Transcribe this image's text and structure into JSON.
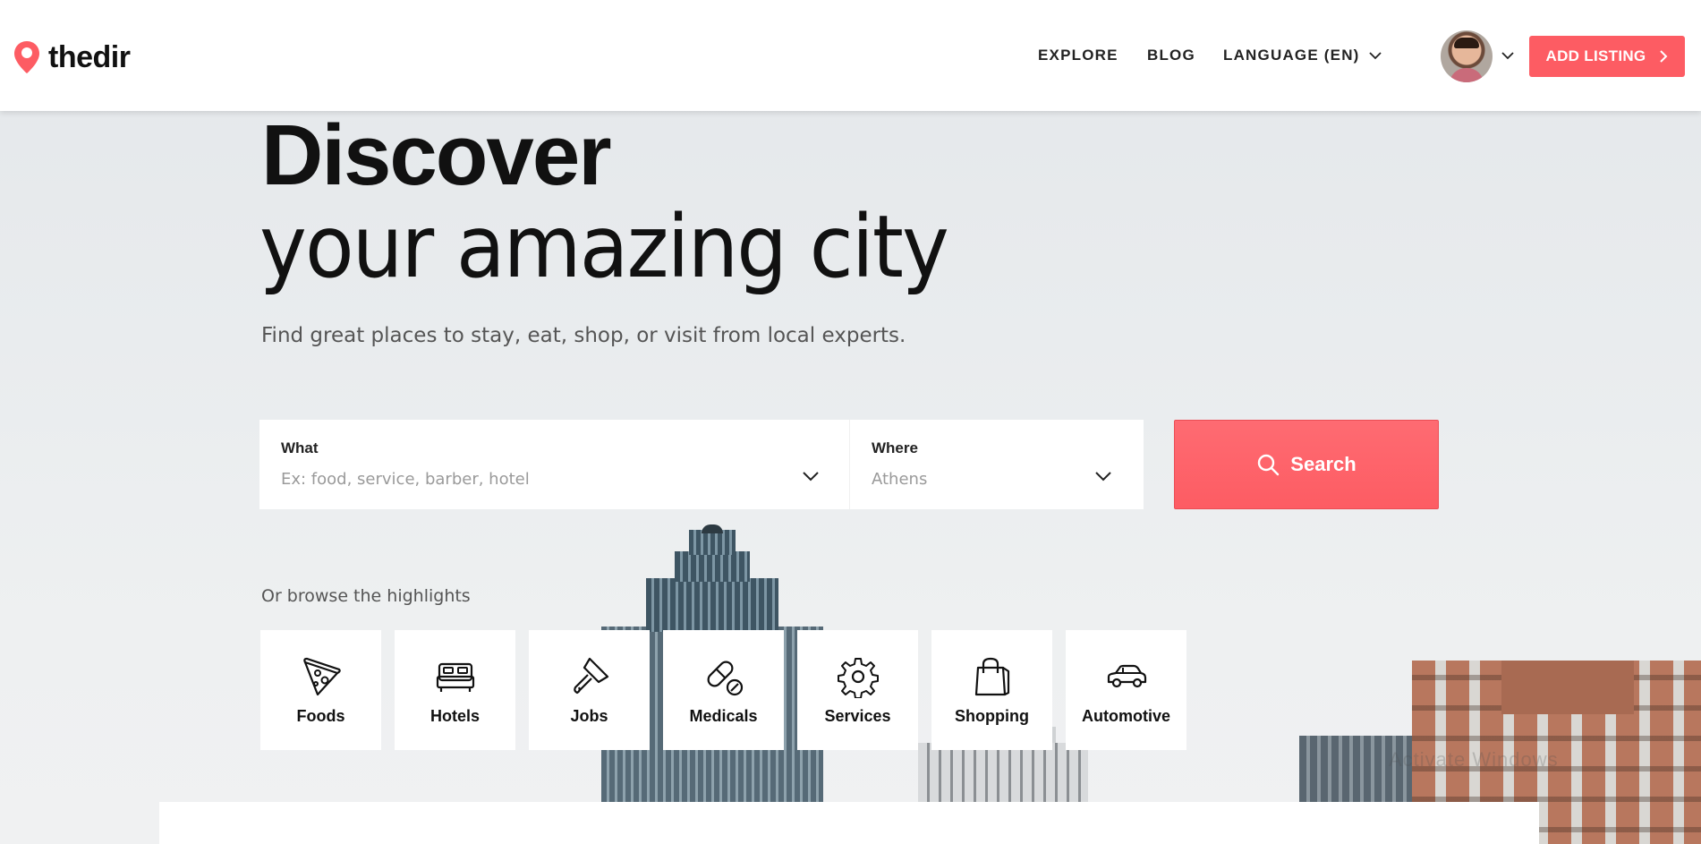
{
  "header": {
    "logo_text": "thedir",
    "nav": {
      "explore": "EXPLORE",
      "blog": "BLOG",
      "language": "LANGUAGE (EN)"
    },
    "add_listing": "ADD LISTING"
  },
  "hero": {
    "title_line1": "Discover",
    "title_line2": "your amazing city",
    "subtitle": "Find great places to stay, eat, shop, or visit from local experts."
  },
  "search": {
    "what_label": "What",
    "what_placeholder": "Ex: food, service, barber, hotel",
    "where_label": "Where",
    "where_placeholder": "Athens",
    "button_label": "Search"
  },
  "highlights": {
    "label": "Or browse the highlights",
    "categories": [
      {
        "label": "Foods",
        "icon": "pizza-icon"
      },
      {
        "label": "Hotels",
        "icon": "bed-icon"
      },
      {
        "label": "Jobs",
        "icon": "paint-brush-icon"
      },
      {
        "label": "Medicals",
        "icon": "pill-icon"
      },
      {
        "label": "Services",
        "icon": "gear-icon"
      },
      {
        "label": "Shopping",
        "icon": "shopping-bag-icon"
      },
      {
        "label": "Automotive",
        "icon": "car-icon"
      }
    ]
  },
  "colors": {
    "accent": "#fd5c63",
    "text_dark": "#111111",
    "text_muted": "#555555"
  },
  "watermark": "Activate Windows"
}
